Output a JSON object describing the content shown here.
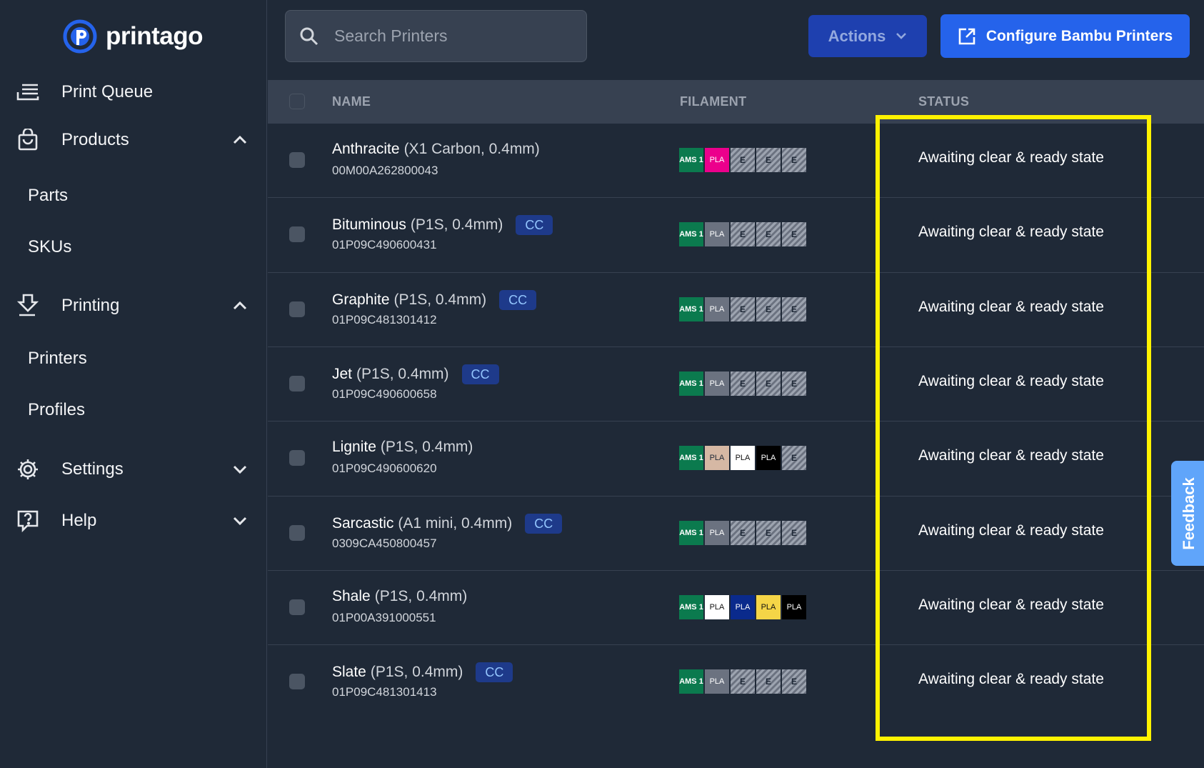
{
  "brand": {
    "name": "printago",
    "accent": "#2563eb"
  },
  "sidebar": {
    "items": [
      {
        "label": "Print Queue"
      },
      {
        "label": "Products",
        "expanded": true,
        "children": [
          {
            "label": "Parts"
          },
          {
            "label": "SKUs"
          }
        ]
      },
      {
        "label": "Printing",
        "expanded": true,
        "children": [
          {
            "label": "Printers"
          },
          {
            "label": "Profiles"
          }
        ]
      },
      {
        "label": "Settings",
        "expanded": false
      },
      {
        "label": "Help",
        "expanded": false
      }
    ]
  },
  "search": {
    "placeholder": "Search Printers",
    "value": ""
  },
  "toolbar": {
    "actions_label": "Actions",
    "configure_label": "Configure Bambu Printers"
  },
  "table": {
    "columns": {
      "name": "NAME",
      "filament": "FILAMENT",
      "status": "STATUS"
    },
    "rows": [
      {
        "name": "Anthracite",
        "details": "(X1 Carbon, 0.4mm)",
        "serial": "00M00A262800043",
        "cc": "",
        "status": "Awaiting clear & ready state",
        "filament": [
          {
            "kind": "ams",
            "text": "AMS 1"
          },
          {
            "kind": "pla",
            "text": "PLA",
            "bg": "#ec008c",
            "fg": "#ffffff"
          },
          {
            "kind": "empty",
            "text": "E"
          },
          {
            "kind": "empty",
            "text": "E"
          },
          {
            "kind": "empty",
            "text": "E"
          }
        ]
      },
      {
        "name": "Bituminous",
        "details": "(P1S, 0.4mm)",
        "serial": "01P09C490600431",
        "cc": "CC",
        "status": "Awaiting clear & ready state",
        "filament": [
          {
            "kind": "ams",
            "text": "AMS 1"
          },
          {
            "kind": "pla",
            "text": "PLA",
            "bg": "#6b7280",
            "fg": "#ffffff"
          },
          {
            "kind": "empty",
            "text": "E"
          },
          {
            "kind": "empty",
            "text": "E"
          },
          {
            "kind": "empty",
            "text": "E"
          }
        ]
      },
      {
        "name": "Graphite",
        "details": "(P1S, 0.4mm)",
        "serial": "01P09C481301412",
        "cc": "CC",
        "status": "Awaiting clear & ready state",
        "filament": [
          {
            "kind": "ams",
            "text": "AMS 1"
          },
          {
            "kind": "pla",
            "text": "PLA",
            "bg": "#6b7280",
            "fg": "#ffffff"
          },
          {
            "kind": "empty",
            "text": "E"
          },
          {
            "kind": "empty",
            "text": "E"
          },
          {
            "kind": "empty",
            "text": "E"
          }
        ]
      },
      {
        "name": "Jet",
        "details": "(P1S, 0.4mm)",
        "serial": "01P09C490600658",
        "cc": "CC",
        "status": "Awaiting clear & ready state",
        "filament": [
          {
            "kind": "ams",
            "text": "AMS 1"
          },
          {
            "kind": "pla",
            "text": "PLA",
            "bg": "#6b7280",
            "fg": "#ffffff"
          },
          {
            "kind": "empty",
            "text": "E"
          },
          {
            "kind": "empty",
            "text": "E"
          },
          {
            "kind": "empty",
            "text": "E"
          }
        ]
      },
      {
        "name": "Lignite",
        "details": "(P1S, 0.4mm)",
        "serial": "01P09C490600620",
        "cc": "",
        "status": "Awaiting clear & ready state",
        "filament": [
          {
            "kind": "ams",
            "text": "AMS 1"
          },
          {
            "kind": "pla",
            "text": "PLA",
            "bg": "#d6b8a4",
            "fg": "#1f2937"
          },
          {
            "kind": "pla",
            "text": "PLA",
            "bg": "#ffffff",
            "fg": "#111111"
          },
          {
            "kind": "pla",
            "text": "PLA",
            "bg": "#000000",
            "fg": "#ffffff"
          },
          {
            "kind": "empty",
            "text": "E"
          }
        ]
      },
      {
        "name": "Sarcastic",
        "details": "(A1 mini, 0.4mm)",
        "serial": "0309CA450800457",
        "cc": "CC",
        "status": "Awaiting clear & ready state",
        "filament": [
          {
            "kind": "ams",
            "text": "AMS 1"
          },
          {
            "kind": "pla",
            "text": "PLA",
            "bg": "#6b7280",
            "fg": "#ffffff"
          },
          {
            "kind": "empty",
            "text": "E"
          },
          {
            "kind": "empty",
            "text": "E"
          },
          {
            "kind": "empty",
            "text": "E"
          }
        ]
      },
      {
        "name": "Shale",
        "details": "(P1S, 0.4mm)",
        "serial": "01P00A391000551",
        "cc": "",
        "status": "Awaiting clear & ready state",
        "filament": [
          {
            "kind": "ams",
            "text": "AMS 1"
          },
          {
            "kind": "pla",
            "text": "PLA",
            "bg": "#ffffff",
            "fg": "#111111"
          },
          {
            "kind": "pla",
            "text": "PLA",
            "bg": "#0a2a8c",
            "fg": "#ffffff"
          },
          {
            "kind": "pla",
            "text": "PLA",
            "bg": "#f5d547",
            "fg": "#111111"
          },
          {
            "kind": "pla",
            "text": "PLA",
            "bg": "#000000",
            "fg": "#ffffff"
          }
        ]
      },
      {
        "name": "Slate",
        "details": "(P1S, 0.4mm)",
        "serial": "01P09C481301413",
        "cc": "CC",
        "status": "Awaiting clear & ready state",
        "filament": [
          {
            "kind": "ams",
            "text": "AMS 1"
          },
          {
            "kind": "pla",
            "text": "PLA",
            "bg": "#6b7280",
            "fg": "#ffffff"
          },
          {
            "kind": "empty",
            "text": "E"
          },
          {
            "kind": "empty",
            "text": "E"
          },
          {
            "kind": "empty",
            "text": "E"
          }
        ]
      }
    ]
  },
  "feedback": {
    "label": "Feedback"
  },
  "colors": {
    "highlight": "#fff200",
    "sidebar_bg": "#1f2937",
    "header_bg": "#374151",
    "ams_green": "#0b7a4e"
  }
}
